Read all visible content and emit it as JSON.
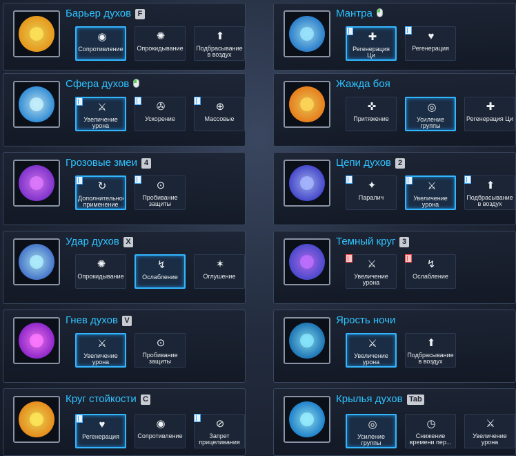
{
  "skills": [
    {
      "name": "Барьер духов",
      "key": "F",
      "mouse": false,
      "options": [
        {
          "label": "Сопротивление",
          "icon": "resist-icon",
          "selected": true,
          "book": ""
        },
        {
          "label": "Опрокидывание",
          "icon": "knockdown-icon",
          "selected": false,
          "book": ""
        },
        {
          "label": "Подбрасывание в воздух",
          "icon": "launch-icon",
          "selected": false,
          "book": ""
        }
      ]
    },
    {
      "name": "Мантра",
      "key": "",
      "mouse": true,
      "options": [
        {
          "label": "Регенерация Ци",
          "icon": "chi-regen-icon",
          "selected": true,
          "book": "blue"
        },
        {
          "label": "Регенерация",
          "icon": "regen-icon",
          "selected": false,
          "book": "blue"
        }
      ]
    },
    {
      "name": "Сфера духов",
      "key": "",
      "mouse": true,
      "options": [
        {
          "label": "Увеличение урона",
          "icon": "damage-up-icon",
          "selected": true,
          "book": "blue"
        },
        {
          "label": "Ускорение",
          "icon": "haste-icon",
          "selected": false,
          "book": "blue"
        },
        {
          "label": "Массовые",
          "icon": "aoe-icon",
          "selected": false,
          "book": "blue"
        }
      ]
    },
    {
      "name": "Жажда боя",
      "key": "",
      "mouse": false,
      "options": [
        {
          "label": "Притяжение",
          "icon": "pull-icon",
          "selected": false,
          "book": ""
        },
        {
          "label": "Усиление группы",
          "icon": "party-buff-icon",
          "selected": true,
          "book": ""
        },
        {
          "label": "Регенерация Ци",
          "icon": "chi-regen-icon",
          "selected": false,
          "book": ""
        }
      ]
    },
    {
      "name": "Грозовые змеи",
      "key": "4",
      "mouse": false,
      "options": [
        {
          "label": "Дополнительное применение",
          "icon": "extra-cast-icon",
          "selected": true,
          "book": "blue"
        },
        {
          "label": "Пробивание защиты",
          "icon": "pierce-icon",
          "selected": false,
          "book": "blue"
        }
      ]
    },
    {
      "name": "Цепи духов",
      "key": "2",
      "mouse": false,
      "options": [
        {
          "label": "Паралич",
          "icon": "paralysis-icon",
          "selected": false,
          "book": "blue"
        },
        {
          "label": "Увеличение урона",
          "icon": "damage-up-icon",
          "selected": true,
          "book": "blue"
        },
        {
          "label": "Подбрасывание в воздух",
          "icon": "launch-icon",
          "selected": false,
          "book": "blue"
        }
      ]
    },
    {
      "name": "Удар духов",
      "key": "X",
      "mouse": false,
      "options": [
        {
          "label": "Опрокидывание",
          "icon": "knockdown-icon",
          "selected": false,
          "book": ""
        },
        {
          "label": "Ослабление",
          "icon": "weaken-icon",
          "selected": true,
          "book": ""
        },
        {
          "label": "Оглушение",
          "icon": "stun-icon",
          "selected": false,
          "book": ""
        }
      ]
    },
    {
      "name": "Темный круг",
      "key": "3",
      "mouse": false,
      "options": [
        {
          "label": "Увеличение урона",
          "icon": "damage-up-icon",
          "selected": false,
          "book": "red"
        },
        {
          "label": "Ослабление",
          "icon": "weaken-icon",
          "selected": false,
          "book": "red"
        }
      ]
    },
    {
      "name": "Гнев духов",
      "key": "V",
      "mouse": false,
      "options": [
        {
          "label": "Увеличение урона",
          "icon": "damage-up-icon",
          "selected": true,
          "book": ""
        },
        {
          "label": "Пробивание защиты",
          "icon": "pierce-icon",
          "selected": false,
          "book": ""
        }
      ]
    },
    {
      "name": "Ярость ночи",
      "key": "",
      "mouse": false,
      "options": [
        {
          "label": "Увеличение урона",
          "icon": "damage-up-icon",
          "selected": true,
          "book": ""
        },
        {
          "label": "Подбрасывание в воздух",
          "icon": "launch-icon",
          "selected": false,
          "book": ""
        }
      ]
    },
    {
      "name": "Круг стойкости",
      "key": "C",
      "mouse": false,
      "options": [
        {
          "label": "Регенерация",
          "icon": "regen-icon",
          "selected": true,
          "book": "blue"
        },
        {
          "label": "Сопротивление",
          "icon": "resist-icon",
          "selected": false,
          "book": ""
        },
        {
          "label": "Запрет прицеливания",
          "icon": "no-target-icon",
          "selected": false,
          "book": "blue"
        }
      ]
    },
    {
      "name": "Крылья духов",
      "key": "Tab",
      "mouse": false,
      "options": [
        {
          "label": "Усиление группы",
          "icon": "party-buff-icon",
          "selected": true,
          "book": ""
        },
        {
          "label": "Снижение времени пер...",
          "icon": "cooldown-icon",
          "selected": false,
          "book": ""
        },
        {
          "label": "Увеличение урона",
          "icon": "damage-up-icon",
          "selected": false,
          "book": ""
        }
      ]
    }
  ],
  "colors": {
    "accent": "#2fc3ff",
    "selected_border": "#34b6ff",
    "book_red": "#ff4b4b"
  }
}
